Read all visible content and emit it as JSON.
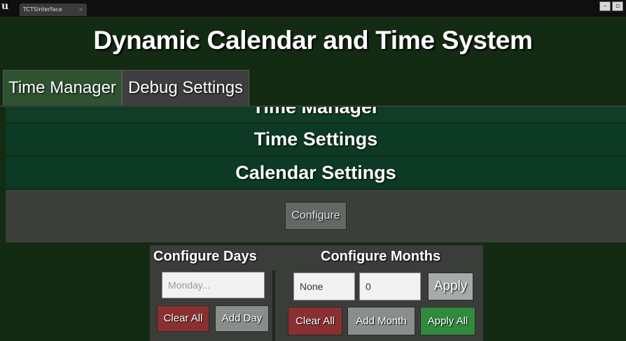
{
  "window": {
    "logo_text": "u",
    "tab_title": "TCTSInterface",
    "tab_close": "×",
    "minimize_glyph": "–",
    "maximize_glyph": "▫"
  },
  "header": {
    "title": "Dynamic Calendar and Time System"
  },
  "tabs": [
    {
      "label": "Time Manager"
    },
    {
      "label": "Debug Settings"
    }
  ],
  "sections": [
    {
      "label": "Time Manager"
    },
    {
      "label": "Time Settings"
    },
    {
      "label": "Calendar Settings"
    }
  ],
  "configure_panel": {
    "button_label": "Configure"
  },
  "configure_days": {
    "heading": "Configure Days",
    "input_placeholder": "Monday...",
    "clear_label": "Clear All",
    "add_label": "Add Day"
  },
  "configure_months": {
    "heading": "Configure Months",
    "name_value": "None",
    "days_value": "0",
    "apply_label": "Apply",
    "clear_label": "Clear All",
    "add_label": "Add Month",
    "apply_all_label": "Apply All"
  },
  "colors": {
    "background": "#132a13",
    "section_green": "#0c3a24",
    "tab_active": "#2f5231",
    "button_red": "#8a3030",
    "button_green": "#2f8a3c",
    "button_gray": "#8a8e8a"
  }
}
